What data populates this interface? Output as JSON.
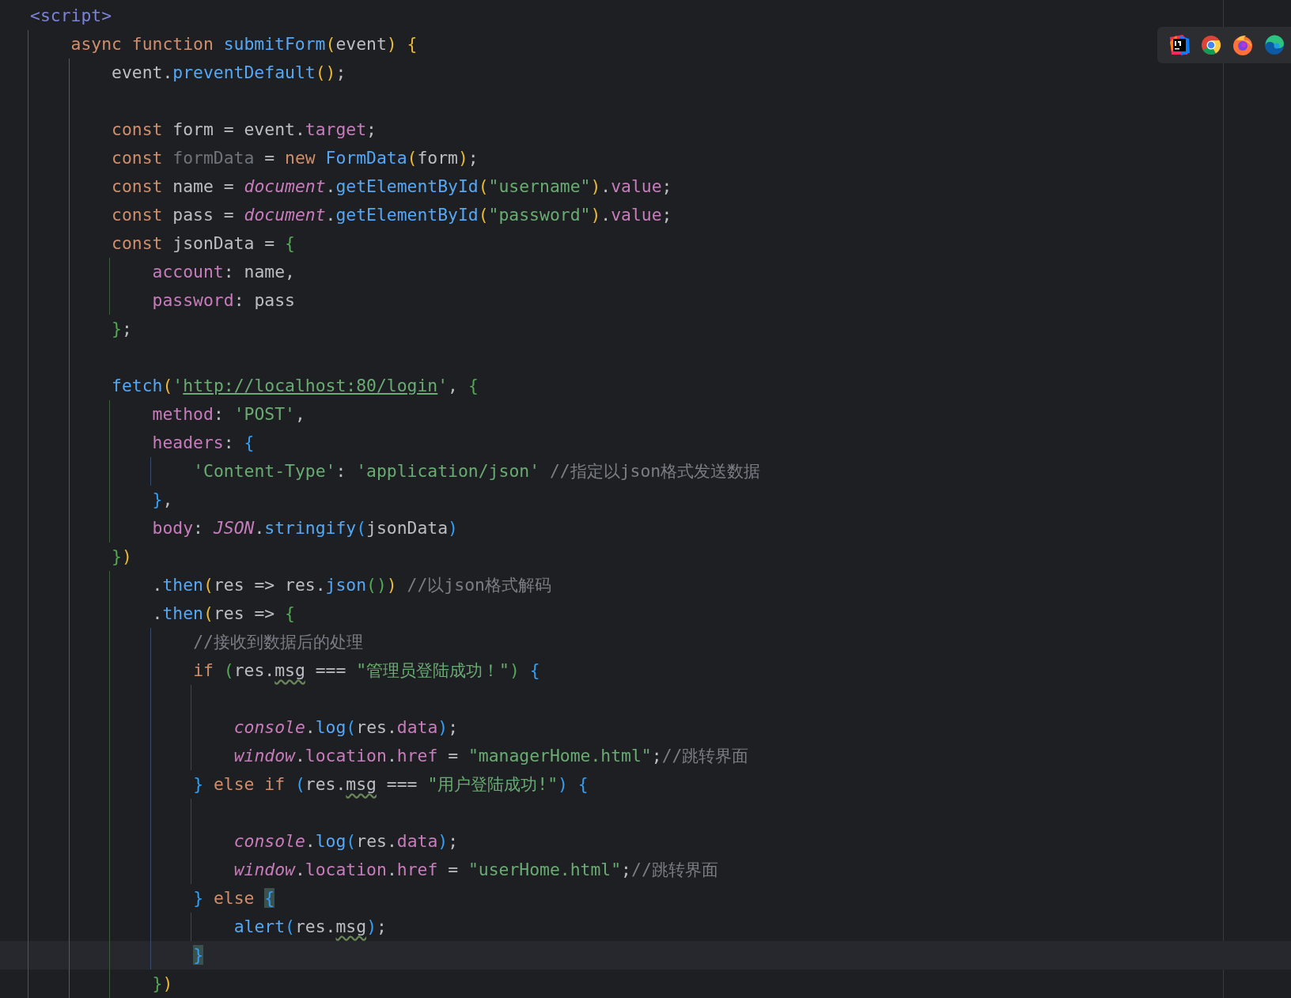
{
  "editor": {
    "lines": [
      {
        "current": false,
        "tokens": [
          {
            "text": "<script>",
            "kind": "tag"
          }
        ],
        "children": [
          {
            "current": false,
            "tokens": [
              {
                "text": "async function ",
                "kind": "kw"
              },
              {
                "text": "submitForm",
                "kind": "fn"
              },
              {
                "text": "(",
                "kind": "b1"
              },
              {
                "text": "event",
                "kind": "plain"
              },
              {
                "text": ") {",
                "kind": "b1"
              }
            ],
            "children": [
              {
                "current": false,
                "tokens": [
                  {
                    "text": "event.",
                    "kind": "plain"
                  },
                  {
                    "text": "preventDefault",
                    "kind": "fn"
                  },
                  {
                    "text": "()",
                    "kind": "b1"
                  },
                  {
                    "text": ";",
                    "kind": "plain"
                  }
                ]
              },
              {
                "current": false
              },
              {
                "current": false,
                "tokens": [
                  {
                    "text": "const ",
                    "kind": "kw"
                  },
                  {
                    "text": "form = event.",
                    "kind": "plain"
                  },
                  {
                    "text": "target",
                    "kind": "prop"
                  },
                  {
                    "text": ";",
                    "kind": "plain"
                  }
                ]
              },
              {
                "current": false,
                "tokens": [
                  {
                    "text": "const ",
                    "kind": "kw"
                  },
                  {
                    "text": "formData",
                    "kind": "unused"
                  },
                  {
                    "text": " = ",
                    "kind": "plain"
                  },
                  {
                    "text": "new ",
                    "kind": "kw"
                  },
                  {
                    "text": "FormData",
                    "kind": "fn"
                  },
                  {
                    "text": "(",
                    "kind": "b1"
                  },
                  {
                    "text": "form",
                    "kind": "plain"
                  },
                  {
                    "text": ")",
                    "kind": "b1"
                  },
                  {
                    "text": ";",
                    "kind": "plain"
                  }
                ]
              },
              {
                "current": false,
                "tokens": [
                  {
                    "text": "const ",
                    "kind": "kw"
                  },
                  {
                    "text": "name = ",
                    "kind": "plain"
                  },
                  {
                    "text": "document",
                    "kind": "glob"
                  },
                  {
                    "text": ".",
                    "kind": "plain"
                  },
                  {
                    "text": "getElementById",
                    "kind": "fn"
                  },
                  {
                    "text": "(",
                    "kind": "b1"
                  },
                  {
                    "text": "\"username\"",
                    "kind": "str"
                  },
                  {
                    "text": ")",
                    "kind": "b1"
                  },
                  {
                    "text": ".",
                    "kind": "plain"
                  },
                  {
                    "text": "value",
                    "kind": "prop"
                  },
                  {
                    "text": ";",
                    "kind": "plain"
                  }
                ]
              },
              {
                "current": false,
                "tokens": [
                  {
                    "text": "const ",
                    "kind": "kw"
                  },
                  {
                    "text": "pass = ",
                    "kind": "plain"
                  },
                  {
                    "text": "document",
                    "kind": "glob"
                  },
                  {
                    "text": ".",
                    "kind": "plain"
                  },
                  {
                    "text": "getElementById",
                    "kind": "fn"
                  },
                  {
                    "text": "(",
                    "kind": "b1"
                  },
                  {
                    "text": "\"password\"",
                    "kind": "str"
                  },
                  {
                    "text": ")",
                    "kind": "b1"
                  },
                  {
                    "text": ".",
                    "kind": "plain"
                  },
                  {
                    "text": "value",
                    "kind": "prop"
                  },
                  {
                    "text": ";",
                    "kind": "plain"
                  }
                ]
              },
              {
                "current": false,
                "tokens": [
                  {
                    "text": "const ",
                    "kind": "kw"
                  },
                  {
                    "text": "jsonData = ",
                    "kind": "plain"
                  },
                  {
                    "text": "{",
                    "kind": "b2"
                  }
                ],
                "children": [
                  {
                    "current": false,
                    "tokens": [
                      {
                        "text": "account",
                        "kind": "prop"
                      },
                      {
                        "text": ": name,",
                        "kind": "plain"
                      }
                    ]
                  },
                  {
                    "current": false,
                    "tokens": [
                      {
                        "text": "password",
                        "kind": "prop"
                      },
                      {
                        "text": ": pass",
                        "kind": "plain"
                      }
                    ]
                  }
                ]
              },
              {
                "current": false,
                "tokens": [
                  {
                    "text": "}",
                    "kind": "b2"
                  },
                  {
                    "text": ";",
                    "kind": "plain"
                  }
                ]
              },
              {
                "current": false
              },
              {
                "current": false,
                "tokens": [
                  {
                    "text": "fetch",
                    "kind": "fn"
                  },
                  {
                    "text": "(",
                    "kind": "b1"
                  },
                  {
                    "text": "'",
                    "kind": "str"
                  },
                  {
                    "text": "http://localhost:80/login",
                    "kind": "link"
                  },
                  {
                    "text": "'",
                    "kind": "str"
                  },
                  {
                    "text": ", ",
                    "kind": "plain"
                  },
                  {
                    "text": "{",
                    "kind": "b2"
                  }
                ],
                "children": [
                  {
                    "current": false,
                    "tokens": [
                      {
                        "text": "method",
                        "kind": "prop"
                      },
                      {
                        "text": ": ",
                        "kind": "plain"
                      },
                      {
                        "text": "'POST'",
                        "kind": "str"
                      },
                      {
                        "text": ",",
                        "kind": "plain"
                      }
                    ]
                  },
                  {
                    "current": false,
                    "tokens": [
                      {
                        "text": "headers",
                        "kind": "prop"
                      },
                      {
                        "text": ": ",
                        "kind": "plain"
                      },
                      {
                        "text": "{",
                        "kind": "b3"
                      }
                    ],
                    "children": [
                      {
                        "current": false,
                        "tokens": [
                          {
                            "text": "'Content-Type'",
                            "kind": "str"
                          },
                          {
                            "text": ": ",
                            "kind": "plain"
                          },
                          {
                            "text": "'application/json'",
                            "kind": "str"
                          },
                          {
                            "text": " //指定以json格式发送数据",
                            "kind": "cmt"
                          }
                        ]
                      }
                    ]
                  },
                  {
                    "current": false,
                    "tokens": [
                      {
                        "text": "}",
                        "kind": "b3"
                      },
                      {
                        "text": ",",
                        "kind": "plain"
                      }
                    ]
                  },
                  {
                    "current": false,
                    "tokens": [
                      {
                        "text": "body",
                        "kind": "prop"
                      },
                      {
                        "text": ": ",
                        "kind": "plain"
                      },
                      {
                        "text": "JSON",
                        "kind": "glob"
                      },
                      {
                        "text": ".",
                        "kind": "plain"
                      },
                      {
                        "text": "stringify",
                        "kind": "fn"
                      },
                      {
                        "text": "(",
                        "kind": "b3"
                      },
                      {
                        "text": "jsonData",
                        "kind": "plain"
                      },
                      {
                        "text": ")",
                        "kind": "b3"
                      }
                    ]
                  }
                ]
              },
              {
                "current": false,
                "tokens": [
                  {
                    "text": "}",
                    "kind": "b2"
                  },
                  {
                    "text": ")",
                    "kind": "b1"
                  }
                ],
                "children": [
                  {
                    "current": false,
                    "tokens": [
                      {
                        "text": ".",
                        "kind": "plain"
                      },
                      {
                        "text": "then",
                        "kind": "fn"
                      },
                      {
                        "text": "(",
                        "kind": "b1"
                      },
                      {
                        "text": "res => res.",
                        "kind": "plain"
                      },
                      {
                        "text": "json",
                        "kind": "fn"
                      },
                      {
                        "text": "()",
                        "kind": "b2"
                      },
                      {
                        "text": ")",
                        "kind": "b1"
                      },
                      {
                        "text": " //以json格式解码",
                        "kind": "cmt"
                      }
                    ]
                  },
                  {
                    "current": false,
                    "tokens": [
                      {
                        "text": ".",
                        "kind": "plain"
                      },
                      {
                        "text": "then",
                        "kind": "fn"
                      },
                      {
                        "text": "(",
                        "kind": "b1"
                      },
                      {
                        "text": "res => ",
                        "kind": "plain"
                      },
                      {
                        "text": "{",
                        "kind": "b2"
                      }
                    ],
                    "children": [
                      {
                        "current": false,
                        "tokens": [
                          {
                            "text": "//接收到数据后的处理",
                            "kind": "cmt"
                          }
                        ]
                      },
                      {
                        "current": false,
                        "tokens": [
                          {
                            "text": "if ",
                            "kind": "kw"
                          },
                          {
                            "text": "(",
                            "kind": "b2"
                          },
                          {
                            "text": "res.",
                            "kind": "plain"
                          },
                          {
                            "text": "msg",
                            "kind": "typo"
                          },
                          {
                            "text": " === ",
                            "kind": "plain"
                          },
                          {
                            "text": "\"管理员登陆成功！\"",
                            "kind": "str"
                          },
                          {
                            "text": ") ",
                            "kind": "b2"
                          },
                          {
                            "text": "{",
                            "kind": "b3"
                          }
                        ],
                        "children": [
                          {
                            "current": false
                          },
                          {
                            "current": false,
                            "tokens": [
                              {
                                "text": "console",
                                "kind": "glob"
                              },
                              {
                                "text": ".",
                                "kind": "plain"
                              },
                              {
                                "text": "log",
                                "kind": "fn"
                              },
                              {
                                "text": "(",
                                "kind": "b3"
                              },
                              {
                                "text": "res.",
                                "kind": "plain"
                              },
                              {
                                "text": "data",
                                "kind": "prop"
                              },
                              {
                                "text": ")",
                                "kind": "b3"
                              },
                              {
                                "text": ";",
                                "kind": "plain"
                              }
                            ]
                          },
                          {
                            "current": false,
                            "tokens": [
                              {
                                "text": "window",
                                "kind": "glob"
                              },
                              {
                                "text": ".",
                                "kind": "plain"
                              },
                              {
                                "text": "location",
                                "kind": "prop"
                              },
                              {
                                "text": ".",
                                "kind": "plain"
                              },
                              {
                                "text": "href",
                                "kind": "prop"
                              },
                              {
                                "text": " = ",
                                "kind": "plain"
                              },
                              {
                                "text": "\"managerHome.html\"",
                                "kind": "str"
                              },
                              {
                                "text": ";",
                                "kind": "plain"
                              },
                              {
                                "text": "//跳转界面",
                                "kind": "cmt"
                              }
                            ]
                          }
                        ]
                      },
                      {
                        "current": false,
                        "tokens": [
                          {
                            "text": "} ",
                            "kind": "b3"
                          },
                          {
                            "text": "else if ",
                            "kind": "kw"
                          },
                          {
                            "text": "(",
                            "kind": "b3"
                          },
                          {
                            "text": "res.",
                            "kind": "plain"
                          },
                          {
                            "text": "msg",
                            "kind": "typo"
                          },
                          {
                            "text": " === ",
                            "kind": "plain"
                          },
                          {
                            "text": "\"用户登陆成功!\"",
                            "kind": "str"
                          },
                          {
                            "text": ") ",
                            "kind": "b3"
                          },
                          {
                            "text": "{",
                            "kind": "b3"
                          }
                        ],
                        "children": [
                          {
                            "current": false
                          },
                          {
                            "current": false,
                            "tokens": [
                              {
                                "text": "console",
                                "kind": "glob"
                              },
                              {
                                "text": ".",
                                "kind": "plain"
                              },
                              {
                                "text": "log",
                                "kind": "fn"
                              },
                              {
                                "text": "(",
                                "kind": "b3"
                              },
                              {
                                "text": "res.",
                                "kind": "plain"
                              },
                              {
                                "text": "data",
                                "kind": "prop"
                              },
                              {
                                "text": ")",
                                "kind": "b3"
                              },
                              {
                                "text": ";",
                                "kind": "plain"
                              }
                            ]
                          },
                          {
                            "current": false,
                            "tokens": [
                              {
                                "text": "window",
                                "kind": "glob"
                              },
                              {
                                "text": ".",
                                "kind": "plain"
                              },
                              {
                                "text": "location",
                                "kind": "prop"
                              },
                              {
                                "text": ".",
                                "kind": "plain"
                              },
                              {
                                "text": "href",
                                "kind": "prop"
                              },
                              {
                                "text": " = ",
                                "kind": "plain"
                              },
                              {
                                "text": "\"userHome.html\"",
                                "kind": "str"
                              },
                              {
                                "text": ";",
                                "kind": "plain"
                              },
                              {
                                "text": "//跳转界面",
                                "kind": "cmt"
                              }
                            ]
                          }
                        ]
                      },
                      {
                        "current": false,
                        "tokens": [
                          {
                            "text": "} ",
                            "kind": "b3"
                          },
                          {
                            "text": "else ",
                            "kind": "kw"
                          },
                          {
                            "text": "{",
                            "kind": "match"
                          }
                        ],
                        "children": [
                          {
                            "current": false,
                            "tokens": [
                              {
                                "text": "alert",
                                "kind": "fn"
                              },
                              {
                                "text": "(",
                                "kind": "b3"
                              },
                              {
                                "text": "res.",
                                "kind": "plain"
                              },
                              {
                                "text": "msg",
                                "kind": "typo"
                              },
                              {
                                "text": ")",
                                "kind": "b3"
                              },
                              {
                                "text": ";",
                                "kind": "plain"
                              }
                            ]
                          }
                        ]
                      },
                      {
                        "current": true,
                        "tokens": [
                          {
                            "text": "}",
                            "kind": "match"
                          }
                        ]
                      }
                    ]
                  },
                  {
                    "current": false,
                    "tokens": [
                      {
                        "text": "}",
                        "kind": "b2"
                      },
                      {
                        "text": ")",
                        "kind": "b1"
                      }
                    ]
                  }
                ]
              }
            ]
          }
        ]
      }
    ]
  },
  "browser_icons": [
    {
      "kind": "ide"
    },
    {
      "kind": "chrome"
    },
    {
      "kind": "firefox"
    },
    {
      "kind": "edge"
    }
  ]
}
